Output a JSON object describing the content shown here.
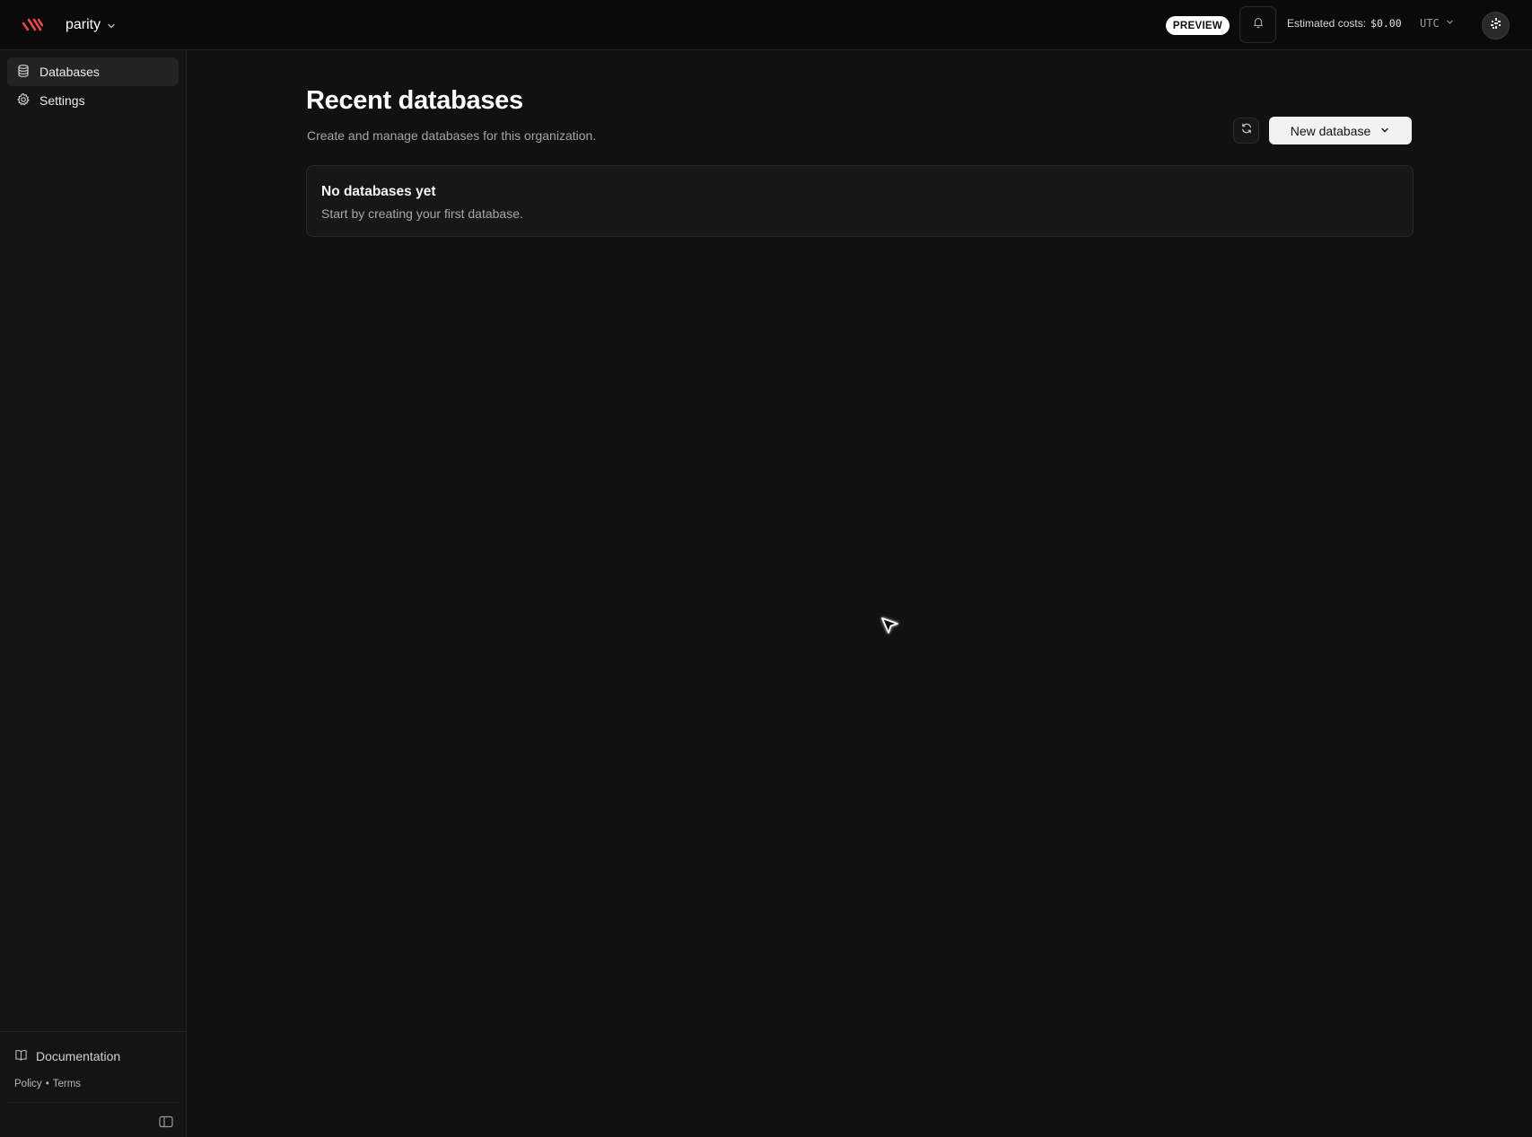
{
  "topbar": {
    "org_name": "parity",
    "badge": "PREVIEW",
    "costs_label": "Estimated costs:",
    "costs_value": "$0.00",
    "timezone": "UTC"
  },
  "sidebar": {
    "items": [
      {
        "label": "Databases",
        "icon": "database-icon",
        "active": true
      },
      {
        "label": "Settings",
        "icon": "gear-icon",
        "active": false
      }
    ],
    "footer": {
      "documentation": "Documentation",
      "policy": "Policy",
      "separator": "•",
      "terms": "Terms"
    }
  },
  "main": {
    "title": "Recent databases",
    "subtitle": "Create and manage databases for this organization.",
    "new_database_label": "New database",
    "empty": {
      "title": "No databases yet",
      "description": "Start by creating your first database."
    }
  },
  "colors": {
    "background": "#111111",
    "topbar": "#0a0a0a",
    "sidebar": "#141414",
    "brand": "#e5484d",
    "primary_button": "#f2f2f2"
  }
}
